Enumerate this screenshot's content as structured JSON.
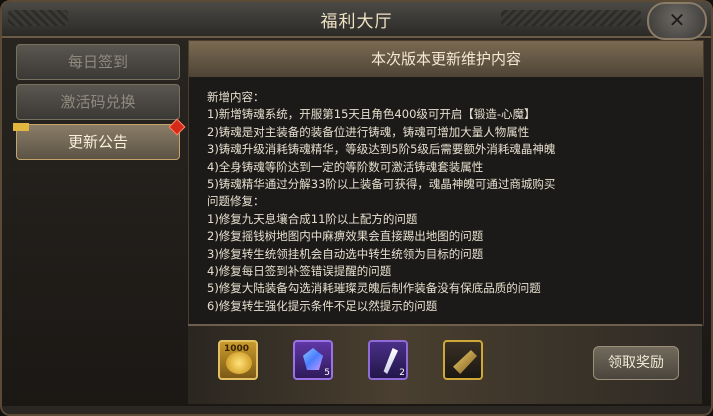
{
  "window": {
    "title": "福利大厅"
  },
  "sidebar": {
    "tabs": [
      {
        "label": "每日签到",
        "active": false
      },
      {
        "label": "激活码兑换",
        "active": false
      },
      {
        "label": "更新公告",
        "active": true
      }
    ]
  },
  "notice": {
    "header": "本次版本更新维护内容",
    "lines": [
      "新增内容：",
      "1)新增铸魂系统，开服第15天且角色400级可开启【锻造-心魔】",
      "2)铸魂是对主装备的装备位进行铸魂，铸魂可增加大量人物属性",
      "3)铸魂升级消耗铸魂精华，等级达到5阶5级后需要额外消耗魂晶神魄",
      "4)全身铸魂等阶达到一定的等阶数可激活铸魂套装属性",
      "5)铸魂精华通过分解33阶以上装备可获得，魂晶神魄可通过商城购买",
      "问题修复：",
      "1)修复九天息壤合成11阶以上配方的问题",
      "2)修复摇钱树地图内中麻痹效果会直接踢出地图的问题",
      "3)修复转生统领挂机会自动选中转生统领为目标的问题",
      "4)修复每日签到补签错误提醒的问题",
      "5)修复大陆装备勾选消耗璀璨灵魄后制作装备没有保底品质的问题",
      "6)修复转生强化提示条件不足以然提示的问题"
    ]
  },
  "rewards": {
    "items": [
      {
        "icon": "gold-coins-icon",
        "label": "1000",
        "count": ""
      },
      {
        "icon": "crystal-icon",
        "count": "5"
      },
      {
        "icon": "feather-icon",
        "count": "2"
      },
      {
        "icon": "blade-icon",
        "count": ""
      }
    ],
    "claim_label": "领取奖励"
  },
  "colors": {
    "accent": "#c4a46a",
    "badge": "#d52a1a"
  }
}
